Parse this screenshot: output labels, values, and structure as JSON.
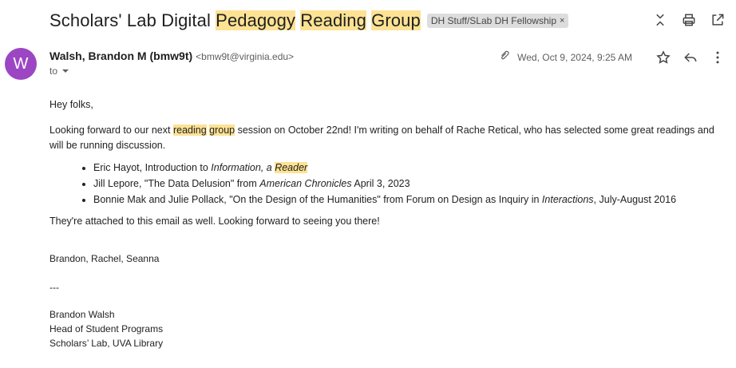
{
  "subject": {
    "part1": "Scholars' Lab Digital ",
    "hl1": "Pedagogy",
    "hl2": "Reading",
    "hl3": "Group",
    "label": "DH Stuff/SLab DH Fellowship",
    "label_close": "×"
  },
  "sender": {
    "avatar_letter": "W",
    "name": "Walsh, Brandon M (bmw9t)",
    "email": "<bmw9t@virginia.edu>",
    "to": "to",
    "date": "Wed, Oct 9, 2024, 9:25 AM"
  },
  "icons": {
    "expand": "unfold-icon",
    "print": "print-icon",
    "popout": "open-in-new-icon",
    "attachment": "paperclip-icon",
    "star": "star-icon",
    "reply": "reply-icon",
    "more": "more-vert-icon"
  },
  "body": {
    "greeting": "Hey folks,",
    "p1_a": "Looking forward to our next ",
    "p1_hl1": "reading",
    "p1_hl2": "group",
    "p1_b": " session on October 22nd! I'm writing on behalf of Rache Retical, who has selected some great readings and will be running discussion.",
    "items": [
      {
        "a": "Eric Hayot, Introduction to ",
        "i": "Information, a ",
        "hl": "Reader",
        "b": ""
      },
      {
        "a": "Jill Lepore, \"The Data Delusion\" from ",
        "i": "American Chronicles",
        "hl": "",
        "b": " April 3, 2023"
      },
      {
        "a": "Bonnie Mak and Julie Pollack, \"On the Design of the Humanities\" from Forum on Design as Inquiry in ",
        "i": "Interactions",
        "hl": "",
        "b": ", July-August 2016"
      }
    ],
    "p2": "They're attached to this email as well. Looking forward to seeing you there!",
    "signoff": "Brandon, Rachel, Seanna",
    "separator": "---",
    "sig_name": "Brandon Walsh",
    "sig_title": "Head of Student Programs",
    "sig_org": "Scholars’ Lab, UVA Library"
  },
  "colors": {
    "highlight": "#fde293",
    "avatar": "#9c46c4"
  }
}
